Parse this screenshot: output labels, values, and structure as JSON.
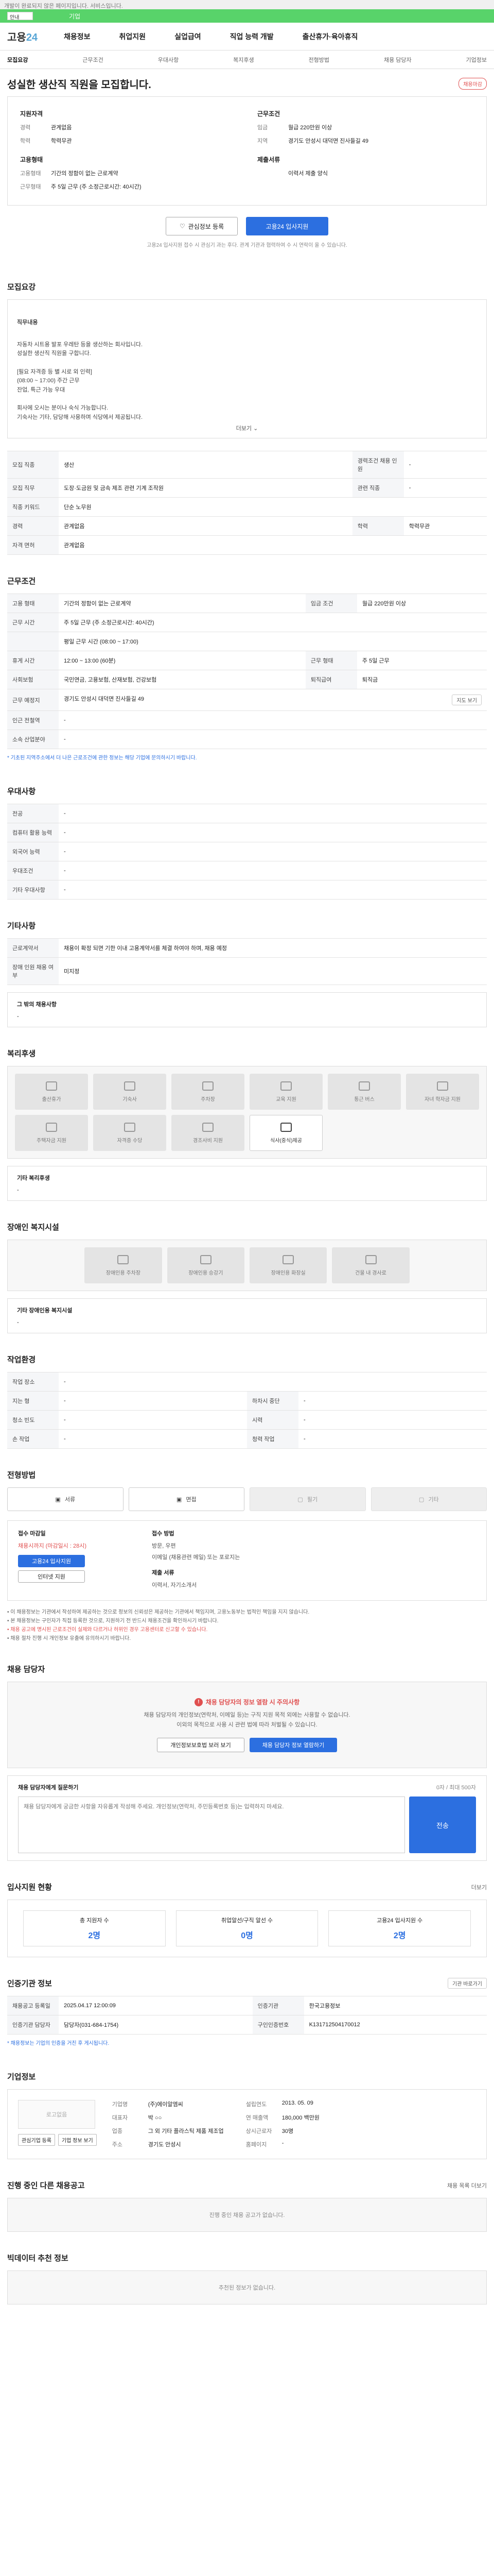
{
  "top_notice": "개발이 완료되지 않은 페이지입니다. 서비스입니다.",
  "green_bar": {
    "select_value": "안내",
    "label": "기업"
  },
  "gnb": {
    "logo_main": "고용",
    "logo_num": "24",
    "menu": [
      "채용정보",
      "취업지원",
      "실업급여",
      "직업 능력 개발",
      "출산휴가·육아휴직"
    ]
  },
  "subnav": [
    "모집요강",
    "근무조건",
    "우대사항",
    "복지후생",
    "전형방법",
    "채용 담당자",
    "기업정보"
  ],
  "headline": {
    "title": "성실한 생산직 직원을 모집합니다.",
    "badge": "채용마감"
  },
  "summary": {
    "left_title": "지원자격",
    "left_rows": [
      {
        "k": "경력",
        "v": "관계없음"
      },
      {
        "k": "학력",
        "v": "학력무관"
      }
    ],
    "left_title2": "고용형태",
    "left_rows2": [
      {
        "k": "고용형태",
        "v": "기간의 정함이 없는 근로계약"
      },
      {
        "k": "근무형태",
        "v": "주 5일 근무 (주 소정근로시간: 40시간)"
      }
    ],
    "right_title": "근무조건",
    "right_rows": [
      {
        "k": "임금",
        "v": "월급 220만원 이상"
      },
      {
        "k": "지역",
        "v": "경기도 안성시 대덕면 진사들길 49"
      }
    ],
    "right_title2": "제출서류",
    "right_rows2": [
      {
        "k": "",
        "v": "이력서 제출 양식"
      }
    ]
  },
  "actions": {
    "save": "관심정보 등록",
    "apply": "고용24 입사지원"
  },
  "action_note": "고용24 입사지원 접수 시 관심기 과는 후다. 관계 기관과 협력하여 수 시 연락이 올 수 있습니다.",
  "recruit": {
    "title": "모집요강",
    "desc_title": "직무내용",
    "desc_body": "자동차 시트용 발포 우레탄 등을 생산하는 회사입니다.\n성실한 생산직 직원을 구합니다.\n\n[필요 자격증 등 별 시로 외 인력]\n(08:00 ~ 17:00) 주간 근무\n잔업, 특근 가능 우대\n\n회사에 오시는 분이나 숙식 가능합니다.\n기숙사는 기타, 담당해 사용하며 식당에서 제공됩니다.",
    "more": "더보기",
    "table": [
      [
        "모집 직종",
        "생산",
        "경력조건 채용 인원",
        "-"
      ],
      [
        "모집 직무",
        "도장·도금원 및 금속 제조 관련 기계 조작원",
        "관련 직종",
        "-"
      ],
      [
        "직종 키워드",
        "단순 노무원",
        "",
        ""
      ],
      [
        "경력",
        "관계없음",
        "학력",
        "학력무관"
      ],
      [
        "자격 면허",
        "관계없음",
        "",
        ""
      ]
    ]
  },
  "conditions": {
    "title": "근무조건",
    "table": [
      [
        "고용 형태",
        "기간의 정함이 없는 근로계약",
        "임금 조건",
        "월급 220만원 이상"
      ],
      [
        "근무 시간",
        "주 5일 근무 (주 소정근로시간: 40시간)",
        "",
        ""
      ],
      [
        "",
        "평일 근무 시간 (08:00 ~ 17:00)",
        "",
        ""
      ],
      [
        "휴게 시간",
        "12:00 ~ 13:00 (60분)",
        "근무 형태",
        "주 5일 근무"
      ],
      [
        "사회보험",
        "국민연금, 고용보험, 산재보험, 건강보험",
        "퇴직급여",
        "퇴직금"
      ],
      [
        "근무 예정지",
        "경기도 안성시 대덕면 진사들길 49",
        "",
        ""
      ],
      [
        "인근 전철역",
        "-",
        "",
        ""
      ],
      [
        "소속 산업분야",
        "-",
        "",
        ""
      ]
    ],
    "map_btn": "지도 보기",
    "footnote": "* 기초된 지역주소에서 더 나은 근로조건에 관한 정보는 해당 기업에 문의하시기 바랍니다."
  },
  "preferred": {
    "title": "우대사항",
    "table": [
      [
        "전공",
        "-"
      ],
      [
        "컴퓨터 활용 능력",
        "-"
      ],
      [
        "외국어 능력",
        "-"
      ],
      [
        "우대조건",
        "-"
      ],
      [
        "기타 우대사항",
        "-"
      ]
    ]
  },
  "other": {
    "title": "기타사항",
    "table": [
      [
        "근로계약서",
        "채용이 확정 되면 기한 이내 고용계약서를 체결 하여야 하며, 채용 예정"
      ],
      [
        "장애 인원 채용 여부",
        "미지정"
      ]
    ],
    "box_title": "그 밖의 채용사항",
    "box_body": "-"
  },
  "welfare": {
    "title": "복리후생",
    "items": [
      {
        "label": "출산휴가",
        "on": false
      },
      {
        "label": "기숙사",
        "on": false
      },
      {
        "label": "주차장",
        "on": false
      },
      {
        "label": "교육 지원",
        "on": false
      },
      {
        "label": "통근 버스",
        "on": false
      },
      {
        "label": "자녀 학자금 지원",
        "on": false
      },
      {
        "label": "주택자금 지원",
        "on": false
      },
      {
        "label": "자격증 수당",
        "on": false
      },
      {
        "label": "경조사비 지원",
        "on": false
      },
      {
        "label": "식사(중식)제공",
        "on": true
      }
    ],
    "box_title": "기타 복리후생",
    "box_body": "-"
  },
  "disabled": {
    "title": "장애인 복지시설",
    "items": [
      "장애인용 주차장",
      "장애인용 승강기",
      "장애인용 화장실",
      "건물 내 경사로"
    ],
    "box_title": "기타 장애인용 복지시설",
    "box_body": "-"
  },
  "workplace": {
    "title": "작업환경",
    "table": [
      [
        "작업 장소",
        "-",
        "",
        ""
      ],
      [
        "지는 형",
        "-",
        "하차시 중단",
        "-"
      ],
      [
        "청소 빈도",
        "-",
        "시력",
        "-"
      ],
      [
        "손 작업",
        "-",
        "청력 작업",
        "-"
      ]
    ]
  },
  "selection": {
    "title": "전형방법",
    "methods": [
      {
        "label": "서류",
        "on": true
      },
      {
        "label": "면접",
        "on": true
      },
      {
        "label": "필기",
        "on": false
      },
      {
        "label": "기타",
        "on": false
      }
    ],
    "apply_title": "접수 마감일",
    "deadline": "채용시까지 (마감일시 : 28시)",
    "apply_btn": "고용24 입사지원",
    "online_btn": "인터넷 지원",
    "method_title": "접수 방법",
    "method_lines": [
      "방문, 우편",
      "이메일 (채용관련 메일) 또는 포로지는"
    ],
    "docs_title": "제출 서류",
    "docs_line": "이력서, 자기소개서",
    "bullets": [
      "이 채용정보는 기관에서 작성하여 제공하는 것으로 정보의 신뢰성은 제공하는 기관에서 책임지며, 고용노동부는 법적인 책임을 지지 않습니다.",
      "본 채용정보는 구인자가 직접 등록한 것으로, 지원하기 전 반드시 채용조건을 확인하시기 바랍니다.",
      "채용 공고에 명시된 근로조건이 실제와 다르거나 허위인 경우 고용센터로 신고할 수 있습니다.",
      "채용 절차 진행 시 개인정보 유출에 유의하시기 바랍니다."
    ]
  },
  "contact": {
    "title": "채용 담당자",
    "warn": "채용 담당자의 정보 열람 시 주의사항",
    "lines": [
      "채용 담당자의 개인정보(연락처, 이메일 등)는 구직 지원 목적 외에는 사용할 수 없습니다.",
      "이외의 목적으로 사용 시 관련 법에 따라 처벌될 수 있습니다."
    ],
    "btn1": "개인정보보호법 보러 보기",
    "btn2": "채용 담당자 정보 열람하기"
  },
  "qa": {
    "title": "채용 담당자에게 질문하기",
    "count": "0자 / 최대 500자",
    "placeholder": "채용 담당자에게 궁금한 사항을 자유롭게 작성해 주세요. 개인정보(연락처, 주민등록번호 등)는 입력하지 마세요.",
    "submit": "전송"
  },
  "status": {
    "title": "입사지원 현황",
    "more": "더보기",
    "cards": [
      {
        "label": "총 지원자 수",
        "n": "2명"
      },
      {
        "label": "취업알선/구직 알선 수",
        "n": "0명"
      },
      {
        "label": "고용24 입사지원 수",
        "n": "2명"
      }
    ]
  },
  "agency": {
    "title": "인증기관 정보",
    "btn": "기관 바로가기",
    "table": [
      [
        "채용공고 등록일",
        "2025.04.17 12:00:09",
        "인증기관",
        "한국고용정보"
      ],
      [
        "인증기관 담당자",
        "담당자(031-684-1754)",
        "구인인증번호",
        "K131712504170012"
      ]
    ],
    "footnote": "* 채용정보는 기업의 인증을 거친 후 게시됩니다."
  },
  "company": {
    "title": "기업정보",
    "logo": "로고없음",
    "btns": [
      "관심기업 등록",
      "기업 정보 보기"
    ],
    "rows": [
      [
        "기업명",
        "(주)에이알엠씨",
        "설립연도",
        "2013. 05. 09"
      ],
      [
        "대표자",
        "박 ○○",
        "연 매출액",
        "180,000 백만원"
      ],
      [
        "업종",
        "그 외 기타 플라스틱 제품 제조업",
        "상시근로자",
        "30명"
      ],
      [
        "주소",
        "경기도 안성시",
        "홈페이지",
        "-"
      ]
    ]
  },
  "related": {
    "title": "진행 중인 다른 채용공고",
    "more": "채용 목록 더보기",
    "empty": "진행 중인 채용 공고가 없습니다."
  },
  "recommend": {
    "title": "빅데이터 추천 정보",
    "empty": "추천된 정보가 없습니다."
  }
}
